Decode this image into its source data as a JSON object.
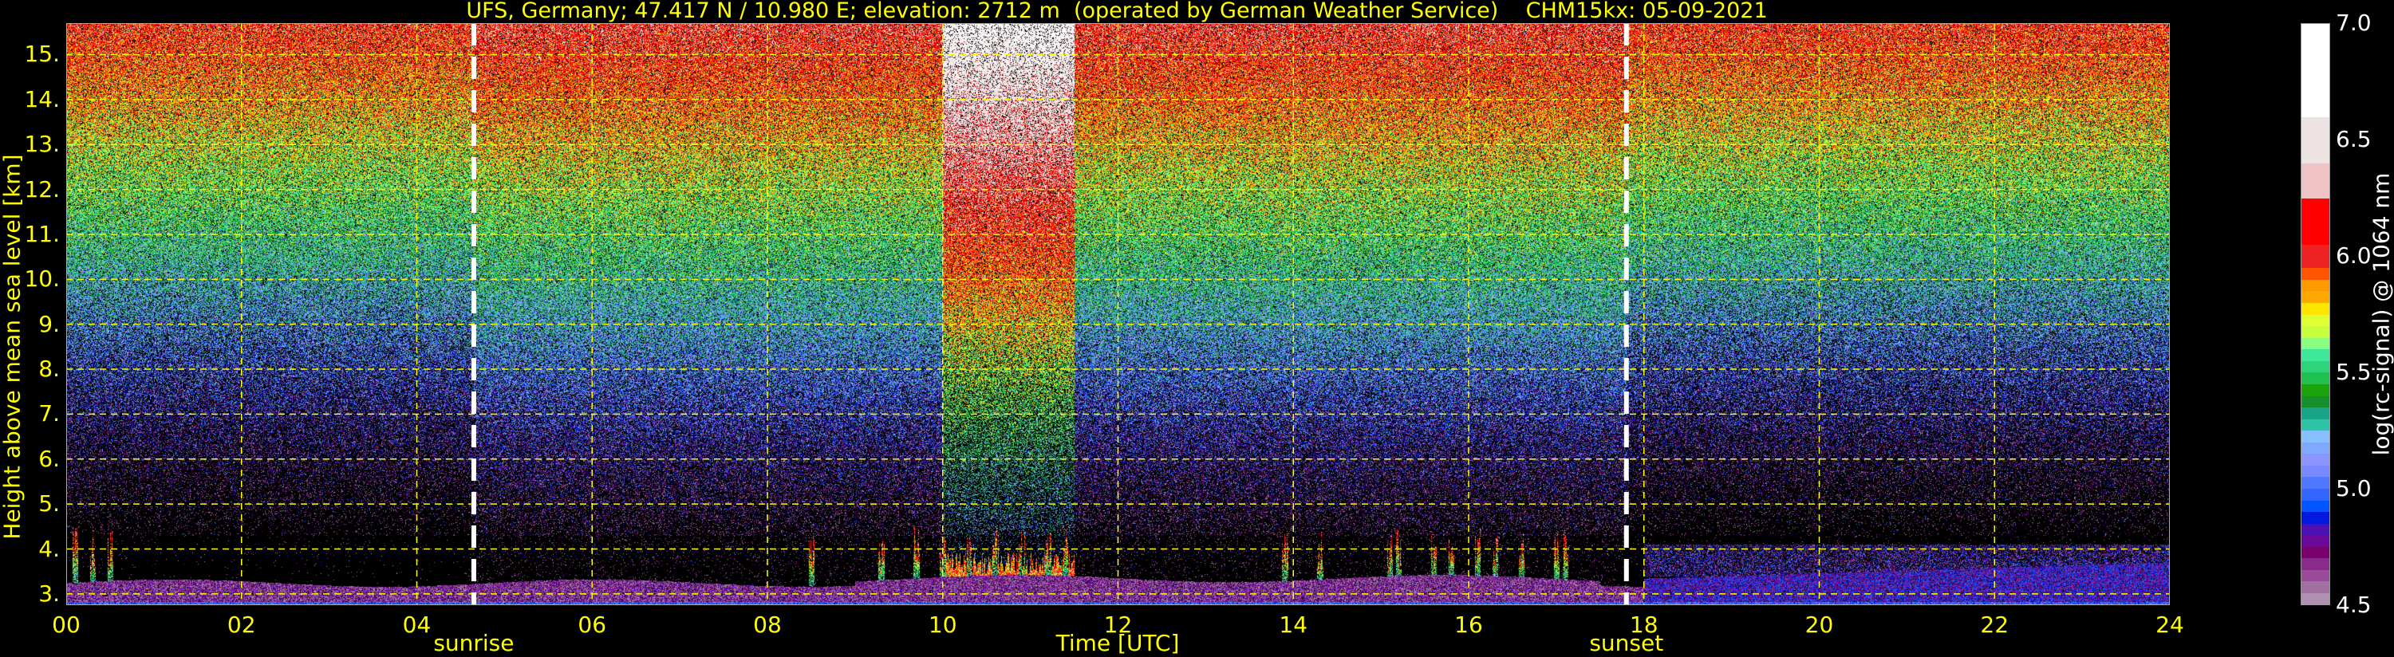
{
  "chart_data": {
    "type": "heatmap",
    "title": "UFS, Germany; 47.417 N / 10.980 E; elevation: 2712 m  (operated by German Weather Service)    CHM15kx: 05-09-2021",
    "xlabel": "Time [UTC]",
    "ylabel": "Height above mean sea level [km]",
    "xlim": [
      0,
      24
    ],
    "ylim": [
      2.75,
      15.7
    ],
    "xticks": [
      "00",
      "02",
      "04",
      "06",
      "08",
      "10",
      "12",
      "14",
      "16",
      "18",
      "20",
      "22",
      "24"
    ],
    "xtick_values": [
      0,
      2,
      4,
      6,
      8,
      10,
      12,
      14,
      16,
      18,
      20,
      22,
      24
    ],
    "yticks": [
      "3.",
      "4.",
      "5.",
      "6.",
      "7.",
      "8.",
      "9.",
      "10.",
      "11.",
      "12.",
      "13.",
      "14.",
      "15."
    ],
    "ytick_values": [
      3,
      4,
      5,
      6,
      7,
      8,
      9,
      10,
      11,
      12,
      13,
      14,
      15
    ],
    "grid": true,
    "annotations": [
      {
        "label": "sunrise",
        "time": 4.65
      },
      {
        "label": "sunset",
        "time": 17.8
      }
    ],
    "colorbar": {
      "label": "log(rc-signal) @ 1064 nm",
      "range": [
        4.5,
        7.0
      ],
      "ticks": [
        "4.5",
        "5.0",
        "5.5",
        "6.0",
        "6.5",
        "7.0"
      ],
      "tick_values": [
        4.5,
        5.0,
        5.5,
        6.0,
        6.5,
        7.0
      ],
      "colors": [
        "#b090b0",
        "#a070a0",
        "#984c98",
        "#8a2a8a",
        "#7a0070",
        "#6a0898",
        "#4a10b0",
        "#0018e0",
        "#0055ff",
        "#3366ff",
        "#5078ff",
        "#7888ff",
        "#8c94ff",
        "#80a8ff",
        "#88c0ff",
        "#2ec4a8",
        "#1aa58a",
        "#15902c",
        "#1aa30a",
        "#1fbf50",
        "#2ed47a",
        "#3de89a",
        "#88ff80",
        "#c8ff3c",
        "#ddff33",
        "#ffe600",
        "#ffaa00",
        "#ff9900",
        "#ff5500",
        "#ee2222",
        "#ff0000",
        "#efc3c3",
        "#ede3e3",
        "#ffffff"
      ],
      "color_bounds": [
        4.5,
        4.55,
        4.6,
        4.65,
        4.7,
        4.75,
        4.8,
        4.85,
        4.9,
        4.95,
        5.0,
        5.05,
        5.1,
        5.15,
        5.2,
        5.25,
        5.3,
        5.35,
        5.4,
        5.45,
        5.5,
        5.55,
        5.6,
        5.65,
        5.7,
        5.75,
        5.8,
        5.85,
        5.9,
        5.95,
        6.05,
        6.25,
        6.4,
        6.6,
        7.0
      ]
    },
    "convective_plume_times": [
      0.1,
      0.3,
      0.5,
      8.5,
      9.3,
      9.7,
      10.0,
      10.3,
      10.6,
      10.9,
      11.2,
      11.4,
      13.9,
      14.3,
      15.1,
      15.2,
      15.6,
      15.8,
      16.1,
      16.3,
      16.6,
      17.0,
      17.1
    ]
  }
}
